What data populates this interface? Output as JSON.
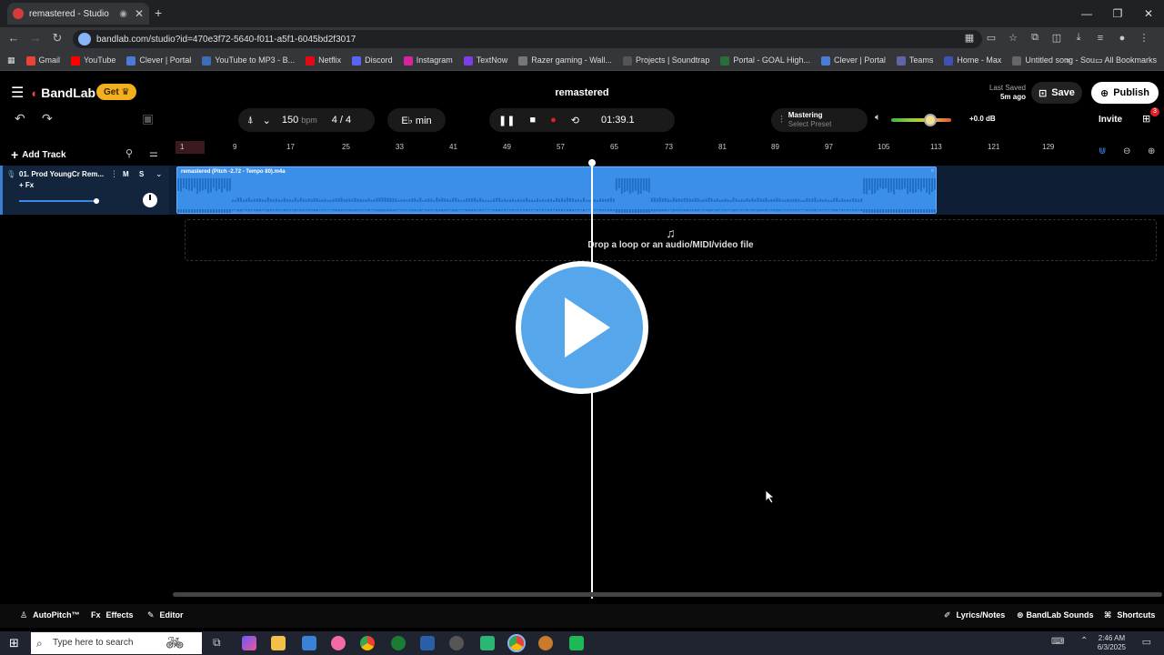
{
  "browser": {
    "tab_title": "remastered - Studio",
    "url": "bandlab.com/studio?id=470e3f72-5640-f011-a5f1-6045bd2f3017",
    "bookmarks": [
      "Gmail",
      "YouTube",
      "Clever | Portal",
      "YouTube to MP3 - B...",
      "Netflix",
      "Discord",
      "Instagram",
      "TextNow",
      "Razer gaming - Wall...",
      "Projects | Soundtrap",
      "Portal - GOAL High...",
      "Clever | Portal",
      "Teams",
      "Home - Max",
      "Untitled song - Sou..."
    ],
    "all_bookmarks": "All Bookmarks"
  },
  "header": {
    "brand": "BandLab",
    "get_label": "Get",
    "project_title": "remastered",
    "last_saved_label": "Last Saved",
    "last_saved_value": "5m ago",
    "save_label": "Save",
    "publish_label": "Publish"
  },
  "transport": {
    "bpm": "150",
    "bpm_unit": "bpm",
    "time_sig": "4 / 4",
    "key": "E♭ min",
    "time": "01:39.1",
    "mastering_label": "Mastering",
    "mastering_preset": "Select Preset",
    "volume_db": "+0.0 dB",
    "invite_label": "Invite",
    "notif_count": "3"
  },
  "tracks": {
    "add_track": "Add Track",
    "track_name": "01. Prod YoungCr Rem...",
    "mute": "M",
    "solo": "S",
    "fx": "+ Fx",
    "clip_title": "remastered (Pitch -2.72 - Tempo 80).m4a"
  },
  "ruler": [
    "1",
    "9",
    "17",
    "25",
    "33",
    "41",
    "49",
    "57",
    "65",
    "73",
    "81",
    "89",
    "97",
    "105",
    "113",
    "121",
    "129"
  ],
  "dropzone": "Drop a loop or an audio/MIDI/video file",
  "bottom": {
    "autopitch": "AutoPitch™",
    "effects": "Effects",
    "editor": "Editor",
    "lyrics": "Lyrics/Notes",
    "sounds": "BandLab Sounds",
    "shortcuts": "Shortcuts"
  },
  "taskbar": {
    "search_placeholder": "Type here to search",
    "time": "2:46 AM",
    "date": "6/3/2025"
  }
}
